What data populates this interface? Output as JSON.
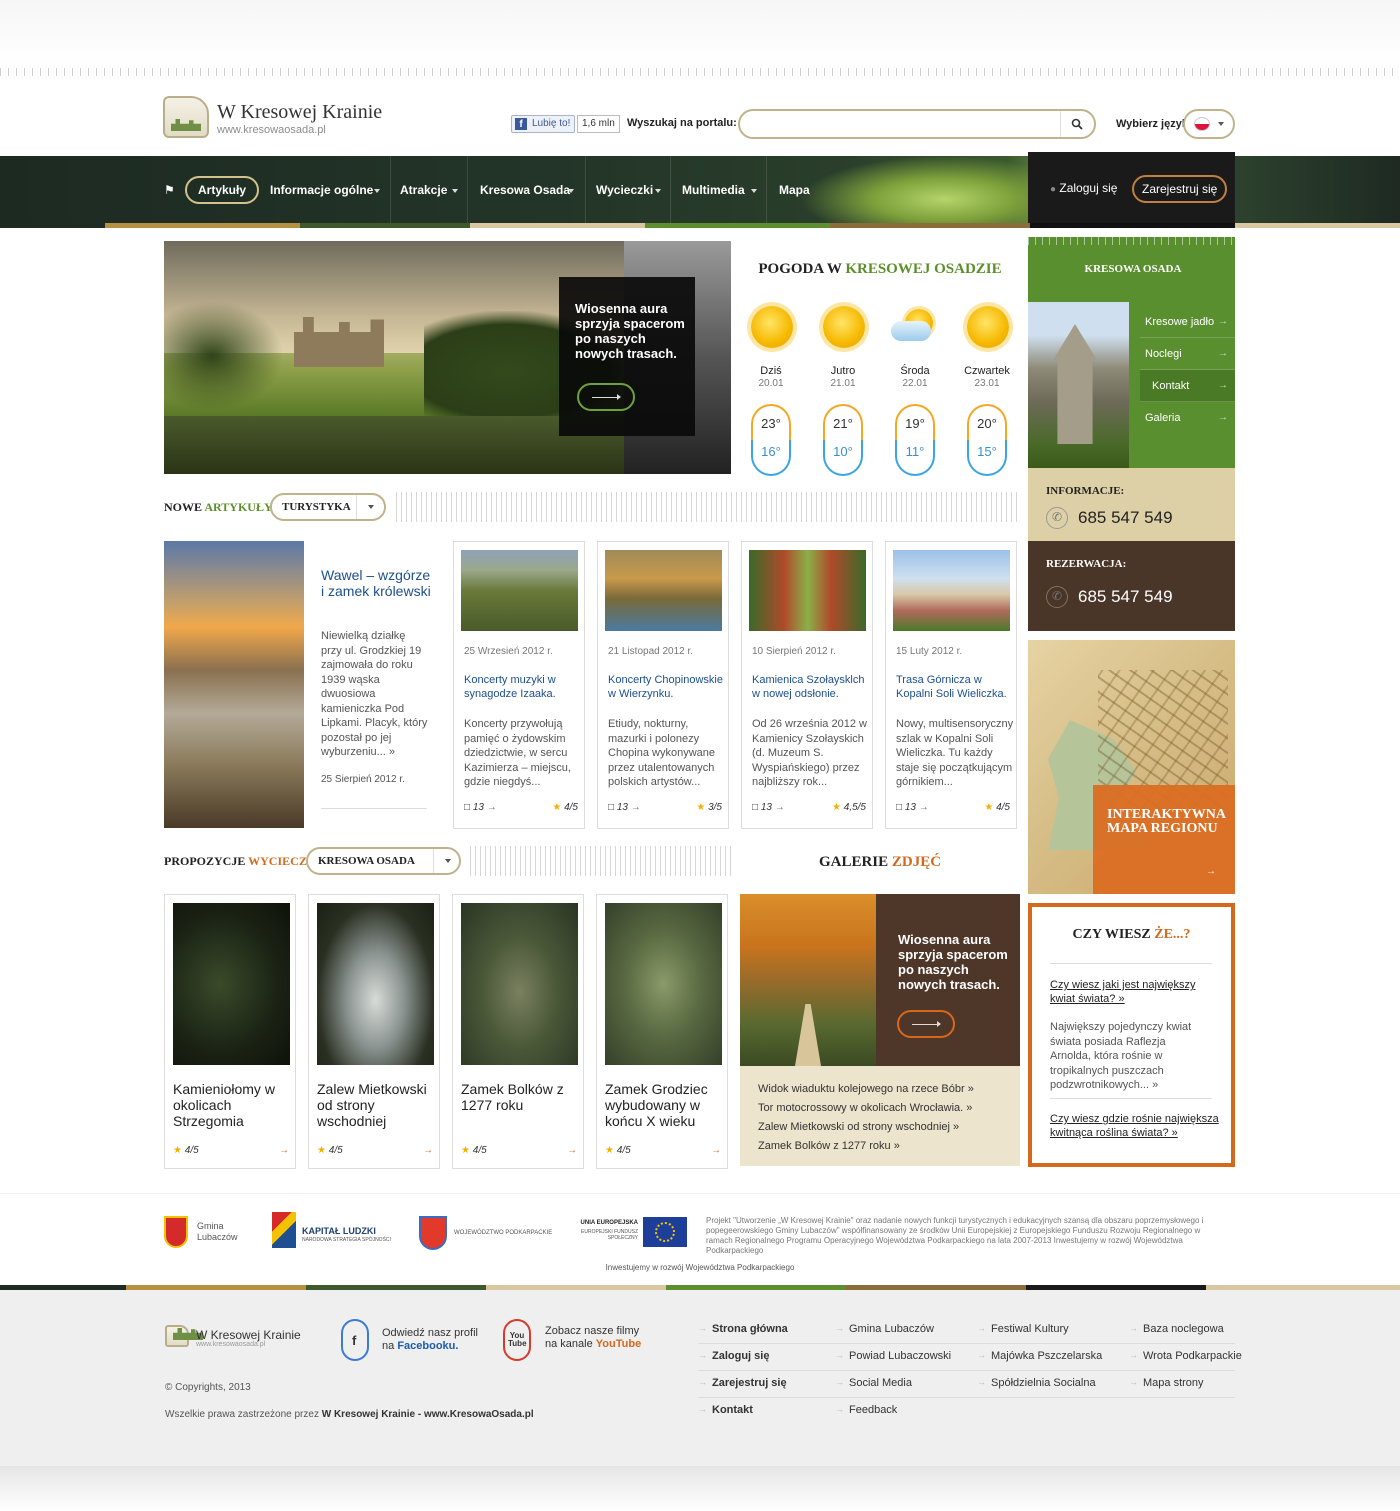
{
  "header": {
    "site_title": "W Kresowej Krainie",
    "site_url": "www.kresowaosada.pl",
    "fb_like": "Lubię to!",
    "fb_count": "1,6 mln",
    "search_label": "Wyszukaj na portalu:",
    "language_label": "Wybierz język:"
  },
  "nav": {
    "items": [
      {
        "label": "Artykuły"
      },
      {
        "label": "Informacje ogólne"
      },
      {
        "label": "Atrakcje"
      },
      {
        "label": "Kresowa Osada"
      },
      {
        "label": "Wycieczki"
      },
      {
        "label": "Multimedia"
      },
      {
        "label": "Mapa"
      }
    ],
    "login": "Zaloguj się",
    "register": "Zarejestruj się"
  },
  "hero": {
    "text": "Wiosenna aura sprzyja spacerom po naszych nowych trasach."
  },
  "weather": {
    "title_prefix": "POGODA W",
    "title_highlight": "KRESOWEJ OSADZIE",
    "days": [
      {
        "day": "Dziś",
        "date": "20.01",
        "high": "23°",
        "low": "16°",
        "icon": "sun-icon"
      },
      {
        "day": "Jutro",
        "date": "21.01",
        "high": "21°",
        "low": "10°",
        "icon": "sun-icon"
      },
      {
        "day": "Środa",
        "date": "22.01",
        "high": "19°",
        "low": "11°",
        "icon": "partly-cloudy-icon"
      },
      {
        "day": "Czwartek",
        "date": "23.01",
        "high": "20°",
        "low": "15°",
        "icon": "sun-icon"
      }
    ]
  },
  "sidebar": {
    "title": "KRESOWA OSADA",
    "links": [
      {
        "label": "Kresowe jadło"
      },
      {
        "label": "Noclegi"
      },
      {
        "label": "Kontakt"
      },
      {
        "label": "Galeria"
      }
    ],
    "info_label": "INFORMACJE:",
    "info_phone": "685 547 549",
    "res_label": "REZERWACJA:",
    "res_phone": "685 547 549",
    "map_text": "INTERAKTYWNA MAPA REGIONU"
  },
  "articles": {
    "title_prefix": "NOWE",
    "title_highlight": "ARTYKUŁY",
    "filter": "TURYSTYKA",
    "featured": {
      "title": "Wawel – wzgórze i zamek królewski",
      "body": "Niewielką działkę przy ul. Grodzkiej 19 zajmowała do roku 1939 wąska dwuosiowa kamieniczka Pod Lipkami. Placyk, który pozostał po jej wyburzeniu... »",
      "date": "25 Sierpień 2012 r."
    },
    "cards": [
      {
        "date": "25 Wrzesień 2012 r.",
        "title": "Koncerty muzyki w synagodze Izaaka.",
        "body": "Koncerty przywołują pamięć o żydowskim dziedzictwie, w sercu Kazimierza – miejscu, gdzie niegdyś...",
        "comments": "13",
        "rating": "4",
        "of": "/5"
      },
      {
        "date": "21 Listopad 2012 r.",
        "title": "Koncerty Chopinowskie w Wierzynku.",
        "body": "Etiudy, nokturny, mazurki i polonezy Chopina wykonywane przez utalentowanych polskich artystów...",
        "comments": "13",
        "rating": "3",
        "of": "/5"
      },
      {
        "date": "10 Sierpień 2012 r.",
        "title": "Kamienica Szołaysklch w nowej odsłonie.",
        "body": "Od 26 września 2012 w Kamienicy Szołayskich (d. Muzeum S. Wyspiańskiego) przez najbliższy rok...",
        "comments": "13",
        "rating": "4,5",
        "of": "/5"
      },
      {
        "date": "15 Luty 2012 r.",
        "title": "Trasa Górnicza w Kopalni Soli Wieliczka.",
        "body": "Nowy, multisensoryczny szlak w Kopalni Soli Wieliczka. Tu każdy staje się początkującym górnikiem...",
        "comments": "13",
        "rating": "4",
        "of": "/5"
      }
    ]
  },
  "trips": {
    "title_prefix": "PROPOZYCJE",
    "title_highlight": "WYCIECZEK",
    "filter": "KRESOWA OSADA",
    "items": [
      {
        "title": "Kamieniołomy w okolicach Strzegomia",
        "rating": "4",
        "of": "/5"
      },
      {
        "title": "Zalew Mietkowski od strony wschodniej",
        "rating": "4",
        "of": "/5"
      },
      {
        "title": "Zamek Bolków z 1277 roku",
        "rating": "4",
        "of": "/5"
      },
      {
        "title": "Zamek Grodziec wybudowany w końcu X wieku",
        "rating": "4",
        "of": "/5"
      }
    ]
  },
  "gallery": {
    "title_prefix": "GALERIE",
    "title_highlight": "ZDJĘĆ",
    "text": "Wiosenna aura sprzyja spacerom po naszych nowych trasach.",
    "links": [
      {
        "label": "Widok wiaduktu kolejowego na rzece Bóbr »"
      },
      {
        "label": "Tor motocrossowy w okolicach Wrocławia. »"
      },
      {
        "label": "Zalew Mietkowski od strony wschodniej »"
      },
      {
        "label": "Zamek Bolków z 1277 roku »"
      }
    ]
  },
  "dyk": {
    "title_prefix": "CZY WIESZ",
    "title_highlight": "ŻE...?",
    "q1": "Czy wiesz jaki jest największy kwiat świata? »",
    "a1": "Największy pojedynczy kwiat świata posiada Raflezja Arnolda, która rośnie w tropikalnych puszczach podzwrotnikowych... »",
    "q2": "Czy wiesz gdzie rośnie największa kwitnąca roślina świata? »"
  },
  "partners": {
    "gmina": "Gmina Lubaczów",
    "kapital": "KAPITAŁ LUDZKI",
    "kapital_sub": "NARODOWA STRATEGIA SPÓJNOŚCI",
    "wojewodztwo": "WOJEWÓDZTWO PODKARPACKIE",
    "ue": "UNIA EUROPEJSKA",
    "ue_sub": "EUROPEJSKI FUNDUSZ SPOŁECZNY",
    "note": "Projekt \"Utworzenie „W Kresowej Krainie\" oraz nadanie nowych funkcji turystycznych i edukacyjnych szansą dla obszaru poprzemysłowego i popegeerowskiego Gminy Lubaczów\" współfinansowany ze środków Unii Europejskiej z Europejskiego Funduszu Rozwoju Regionalnego w ramach Regionalnego Programu Operacyjnego Województwa Podkarpackiego na lata 2007-2013 Inwestujemy w rozwój Województwa Podkarpackiego",
    "invest": "Inwestujemy w rozwój Województwa Podkarpackiego"
  },
  "footer": {
    "title": "W Kresowej Krainie",
    "url": "www.kresowaosada.pl",
    "fb_text": "Odwiedź nasz profil",
    "fb_on": "na",
    "fb_bold": "Facebooku.",
    "yt_text": "Zobacz nasze filmy",
    "yt_on": "na kanale",
    "yt_bold": "YouTube",
    "copyright": "© Copyrights, 2013",
    "rights_prefix": "Wszelkie prawa zastrzeżone przez",
    "rights_bold": "W Kresowej Krainie - www.KresowaOsada.pl",
    "col1": [
      {
        "label": "Strona główna"
      },
      {
        "label": "Zaloguj się"
      },
      {
        "label": "Zarejestruj się"
      },
      {
        "label": "Kontakt"
      }
    ],
    "col2": [
      {
        "label": "Gmina Lubaczów"
      },
      {
        "label": "Powiad Lubaczowski"
      },
      {
        "label": "Social Media"
      },
      {
        "label": "Feedback"
      }
    ],
    "col3": [
      {
        "label": "Festiwal Kultury"
      },
      {
        "label": "Majówka Pszczelarska"
      },
      {
        "label": "Spółdzielnia Socialna"
      }
    ],
    "col4": [
      {
        "label": "Baza noclegowa"
      },
      {
        "label": "Wrota Podkarpackie"
      },
      {
        "label": "Mapa strony"
      }
    ]
  }
}
